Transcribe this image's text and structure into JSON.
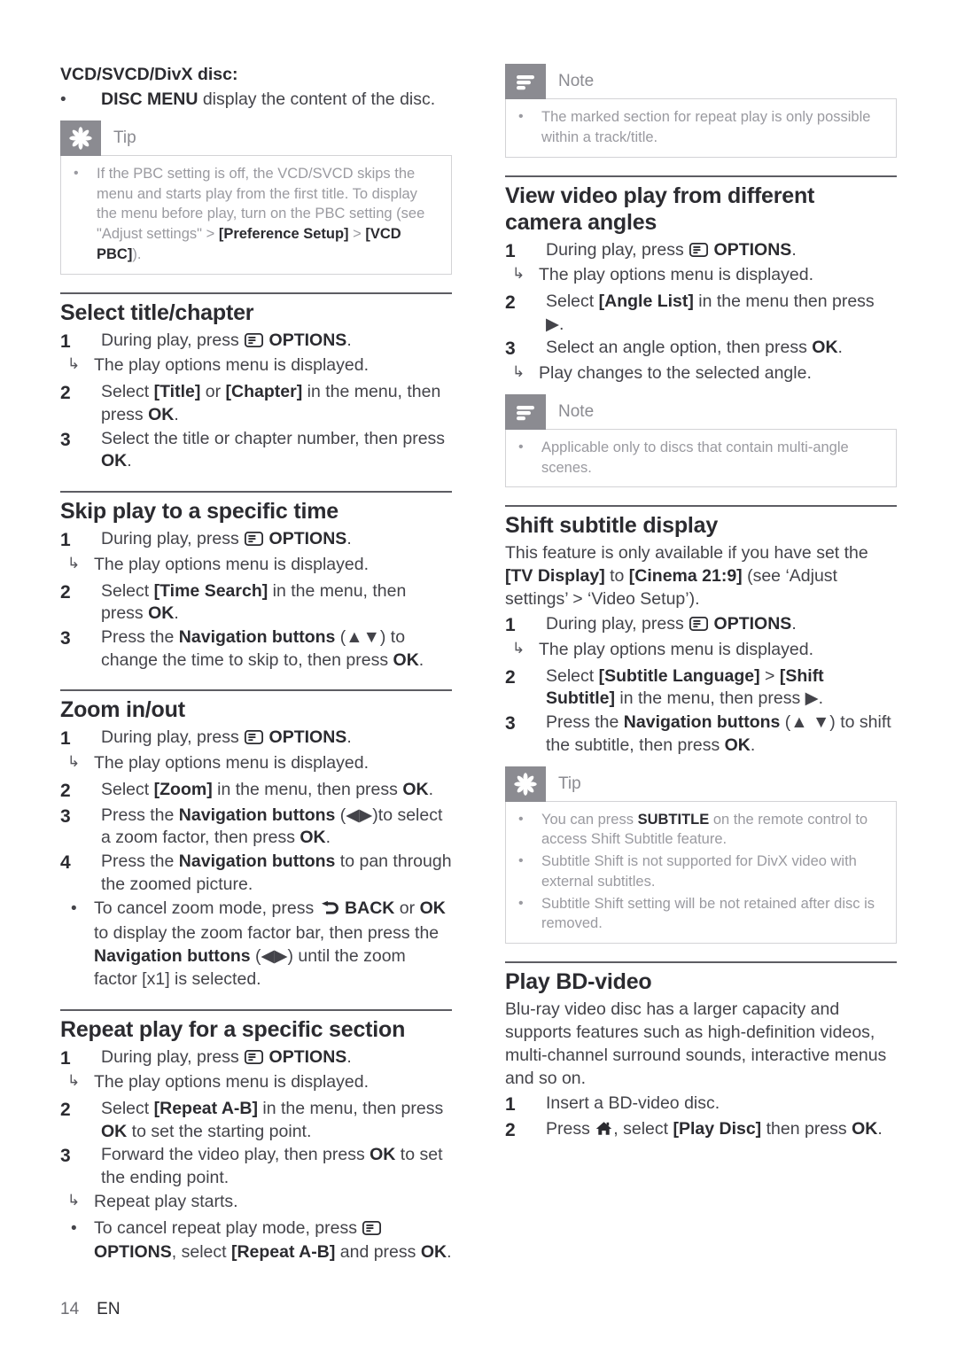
{
  "document": {
    "footer": {
      "page_number": "14",
      "language": "EN"
    }
  },
  "left_column": {
    "disc_list": {
      "heading": "VCD/SVCD/DivX disc:",
      "bullet_text_bold": "DISC MENU",
      "bullet_text_rest": " display the content of the disc."
    },
    "tip_box": {
      "label": "Tip",
      "icon": "tip-asterisk-icon",
      "items": [
        {
          "parts": [
            {
              "text": "If the PBC setting is off, the VCD/SVCD skips the menu and starts play from the first title. To display the menu before play, turn on the PBC setting (see \"Adjust settings\" > ",
              "bold": false
            },
            {
              "text": "[Preference Setup]",
              "bold": true
            },
            {
              "text": " > ",
              "bold": false
            },
            {
              "text": "[VCD PBC]",
              "bold": true
            },
            {
              "text": ").",
              "bold": false
            }
          ]
        }
      ]
    },
    "sections": [
      {
        "title": "Select title/chapter",
        "steps": [
          {
            "num": "1",
            "parts": [
              {
                "text": "During play, press ",
                "bold": false
              },
              {
                "icon": "options-icon"
              },
              {
                "text": " OPTIONS",
                "bold": true
              },
              {
                "text": ".",
                "bold": false
              }
            ],
            "follow": [
              {
                "type": "arrow",
                "text": "The play options menu is displayed."
              }
            ]
          },
          {
            "num": "2",
            "parts": [
              {
                "text": "Select ",
                "bold": false
              },
              {
                "text": "[Title]",
                "bold": true
              },
              {
                "text": " or ",
                "bold": false
              },
              {
                "text": "[Chapter]",
                "bold": true
              },
              {
                "text": " in the menu, then press ",
                "bold": false
              },
              {
                "text": "OK",
                "bold": true
              },
              {
                "text": ".",
                "bold": false
              }
            ],
            "follow": []
          },
          {
            "num": "3",
            "parts": [
              {
                "text": "Select the title or chapter number, then press ",
                "bold": false
              },
              {
                "text": "OK",
                "bold": true
              },
              {
                "text": ".",
                "bold": false
              }
            ],
            "follow": []
          }
        ]
      },
      {
        "title": "Skip play to a specific time",
        "steps": [
          {
            "num": "1",
            "parts": [
              {
                "text": "During play, press ",
                "bold": false
              },
              {
                "icon": "options-icon"
              },
              {
                "text": " OPTIONS",
                "bold": true
              },
              {
                "text": ".",
                "bold": false
              }
            ],
            "follow": [
              {
                "type": "arrow",
                "text": "The play options menu is displayed."
              }
            ]
          },
          {
            "num": "2",
            "parts": [
              {
                "text": "Select ",
                "bold": false
              },
              {
                "text": "[Time Search]",
                "bold": true
              },
              {
                "text": " in the menu, then press ",
                "bold": false
              },
              {
                "text": "OK",
                "bold": true
              },
              {
                "text": ".",
                "bold": false
              }
            ],
            "follow": []
          },
          {
            "num": "3",
            "parts": [
              {
                "text": "Press the ",
                "bold": false
              },
              {
                "text": "Navigation buttons",
                "bold": true
              },
              {
                "text": " (▲▼) to change the time to skip to, then press ",
                "bold": false
              },
              {
                "text": "OK",
                "bold": true
              },
              {
                "text": ".",
                "bold": false
              }
            ],
            "follow": []
          }
        ]
      },
      {
        "title": "Zoom in/out",
        "steps": [
          {
            "num": "1",
            "parts": [
              {
                "text": "During play, press ",
                "bold": false
              },
              {
                "icon": "options-icon"
              },
              {
                "text": " OPTIONS",
                "bold": true
              },
              {
                "text": ".",
                "bold": false
              }
            ],
            "follow": [
              {
                "type": "arrow",
                "text": "The play options menu is displayed."
              }
            ]
          },
          {
            "num": "2",
            "parts": [
              {
                "text": "Select ",
                "bold": false
              },
              {
                "text": "[Zoom]",
                "bold": true
              },
              {
                "text": " in the menu, then press ",
                "bold": false
              },
              {
                "text": "OK",
                "bold": true
              },
              {
                "text": ".",
                "bold": false
              }
            ],
            "follow": []
          },
          {
            "num": "3",
            "parts": [
              {
                "text": "Press the ",
                "bold": false
              },
              {
                "text": "Navigation buttons",
                "bold": true
              },
              {
                "text": " (◀▶)to select a zoom factor, then press ",
                "bold": false
              },
              {
                "text": "OK",
                "bold": true
              },
              {
                "text": ".",
                "bold": false
              }
            ],
            "follow": []
          },
          {
            "num": "4",
            "parts": [
              {
                "text": "Press the ",
                "bold": false
              },
              {
                "text": "Navigation buttons",
                "bold": true
              },
              {
                "text": " to pan through the zoomed picture.",
                "bold": false
              }
            ],
            "follow": [
              {
                "type": "bullet",
                "parts": [
                  {
                    "text": "To cancel zoom mode, press ",
                    "bold": false
                  },
                  {
                    "icon": "back-arrow-icon"
                  },
                  {
                    "text": " BACK",
                    "bold": true
                  },
                  {
                    "text": " or ",
                    "bold": false
                  },
                  {
                    "text": "OK",
                    "bold": true
                  },
                  {
                    "text": " to display the zoom factor bar, then press the ",
                    "bold": false
                  },
                  {
                    "text": "Navigation buttons",
                    "bold": true
                  },
                  {
                    "text": " (◀▶) until the zoom factor [x1] is selected.",
                    "bold": false
                  }
                ]
              }
            ]
          }
        ]
      },
      {
        "title": "Repeat play for a specific section",
        "steps": [
          {
            "num": "1",
            "parts": [
              {
                "text": "During play, press ",
                "bold": false
              },
              {
                "icon": "options-icon"
              },
              {
                "text": " OPTIONS",
                "bold": true
              },
              {
                "text": ".",
                "bold": false
              }
            ],
            "follow": [
              {
                "type": "arrow",
                "text": "The play options menu is displayed."
              }
            ]
          },
          {
            "num": "2",
            "parts": [
              {
                "text": "Select ",
                "bold": false
              },
              {
                "text": "[Repeat A-B]",
                "bold": true
              },
              {
                "text": " in the menu, then press ",
                "bold": false
              },
              {
                "text": "OK",
                "bold": true
              },
              {
                "text": " to set the starting point.",
                "bold": false
              }
            ],
            "follow": []
          },
          {
            "num": "3",
            "parts": [
              {
                "text": "Forward the video play, then press ",
                "bold": false
              },
              {
                "text": "OK",
                "bold": true
              },
              {
                "text": " to set the ending point.",
                "bold": false
              }
            ],
            "follow": [
              {
                "type": "arrow",
                "text": "Repeat play starts."
              },
              {
                "type": "bullet",
                "parts": [
                  {
                    "text": "To cancel repeat play mode, press ",
                    "bold": false
                  },
                  {
                    "icon": "options-icon"
                  },
                  {
                    "text": " OPTIONS",
                    "bold": true
                  },
                  {
                    "text": ", select ",
                    "bold": false
                  },
                  {
                    "text": "[Repeat A-B]",
                    "bold": true
                  },
                  {
                    "text": " and press ",
                    "bold": false
                  },
                  {
                    "text": "OK",
                    "bold": true
                  },
                  {
                    "text": ".",
                    "bold": false
                  }
                ]
              }
            ]
          }
        ]
      }
    ]
  },
  "right_column": {
    "note_box_1": {
      "label": "Note",
      "icon": "note-lines-icon",
      "items": [
        {
          "parts": [
            {
              "text": "The marked section for repeat play is only possible within a track/title.",
              "bold": false
            }
          ]
        }
      ]
    },
    "camera_angles": {
      "title": "View video play from different camera angles",
      "steps": [
        {
          "num": "1",
          "parts": [
            {
              "text": "During play, press ",
              "bold": false
            },
            {
              "icon": "options-icon"
            },
            {
              "text": " OPTIONS",
              "bold": true
            },
            {
              "text": ".",
              "bold": false
            }
          ],
          "follow": [
            {
              "type": "arrow",
              "text": "The play options menu is displayed."
            }
          ]
        },
        {
          "num": "2",
          "parts": [
            {
              "text": "Select ",
              "bold": false
            },
            {
              "text": "[Angle List]",
              "bold": true
            },
            {
              "text": " in the menu then press ▶.",
              "bold": false
            }
          ],
          "follow": []
        },
        {
          "num": "3",
          "parts": [
            {
              "text": "Select an angle option, then press ",
              "bold": false
            },
            {
              "text": "OK",
              "bold": true
            },
            {
              "text": ".",
              "bold": false
            }
          ],
          "follow": [
            {
              "type": "arrow",
              "text": "Play changes to the selected angle."
            }
          ]
        }
      ]
    },
    "note_box_2": {
      "label": "Note",
      "icon": "note-lines-icon",
      "items": [
        {
          "parts": [
            {
              "text": "Applicable only to discs that contain multi-angle scenes.",
              "bold": false
            }
          ]
        }
      ]
    },
    "shift_subtitle": {
      "title": "Shift subtitle display",
      "intro_parts": [
        {
          "text": "This feature is only available if you have set the ",
          "bold": false
        },
        {
          "text": "[TV Display]",
          "bold": true
        },
        {
          "text": " to ",
          "bold": false
        },
        {
          "text": "[Cinema 21:9]",
          "bold": true
        },
        {
          "text": " (see ‘Adjust settings’ > ‘Video Setup’).",
          "bold": false
        }
      ],
      "steps": [
        {
          "num": "1",
          "parts": [
            {
              "text": "During play, press ",
              "bold": false
            },
            {
              "icon": "options-icon"
            },
            {
              "text": " OPTIONS",
              "bold": true
            },
            {
              "text": ".",
              "bold": false
            }
          ],
          "follow": [
            {
              "type": "arrow",
              "text": "The play options menu is displayed."
            }
          ]
        },
        {
          "num": "2",
          "parts": [
            {
              "text": "Select ",
              "bold": false
            },
            {
              "text": "[Subtitle Language]",
              "bold": true
            },
            {
              "text": " > ",
              "bold": false
            },
            {
              "text": "[Shift Subtitle]",
              "bold": true
            },
            {
              "text": " in the menu, then press ▶.",
              "bold": false
            }
          ],
          "follow": []
        },
        {
          "num": "3",
          "parts": [
            {
              "text": "Press the ",
              "bold": false
            },
            {
              "text": "Navigation buttons",
              "bold": true
            },
            {
              "text": " (▲ ▼) to shift the subtitle, then press ",
              "bold": false
            },
            {
              "text": "OK",
              "bold": true
            },
            {
              "text": ".",
              "bold": false
            }
          ],
          "follow": []
        }
      ]
    },
    "tip_box": {
      "label": "Tip",
      "icon": "tip-asterisk-icon",
      "items": [
        {
          "parts": [
            {
              "text": "You can press ",
              "bold": false
            },
            {
              "text": "SUBTITLE",
              "bold": true
            },
            {
              "text": " on the remote control to access Shift Subtitle feature.",
              "bold": false
            }
          ]
        },
        {
          "parts": [
            {
              "text": "Subtitle Shift is not supported for DivX video with external subtitles.",
              "bold": false
            }
          ]
        },
        {
          "parts": [
            {
              "text": "Subtitle Shift setting will be not retained after disc is removed.",
              "bold": false
            }
          ]
        }
      ]
    },
    "play_bd_video": {
      "title": "Play BD-video",
      "intro_parts": [
        {
          "text": "Blu-ray video disc has a larger capacity and supports features such as high-definition videos, multi-channel surround sounds, interactive menus and so on.",
          "bold": false
        }
      ],
      "steps": [
        {
          "num": "1",
          "parts": [
            {
              "text": "Insert a BD-video disc.",
              "bold": false
            }
          ],
          "follow": []
        },
        {
          "num": "2",
          "parts": [
            {
              "text": "Press ",
              "bold": false
            },
            {
              "icon": "home-icon"
            },
            {
              "text": ", select ",
              "bold": false
            },
            {
              "text": "[Play Disc]",
              "bold": true
            },
            {
              "text": " then press ",
              "bold": false
            },
            {
              "text": "OK",
              "bold": true
            },
            {
              "text": ".",
              "bold": false
            }
          ],
          "follow": []
        }
      ]
    }
  },
  "colors": {
    "badge_gray": "#8b8b91",
    "callout_text": "#9a9aa0",
    "rule": "#5d5d63",
    "body_text": "#44444a"
  }
}
